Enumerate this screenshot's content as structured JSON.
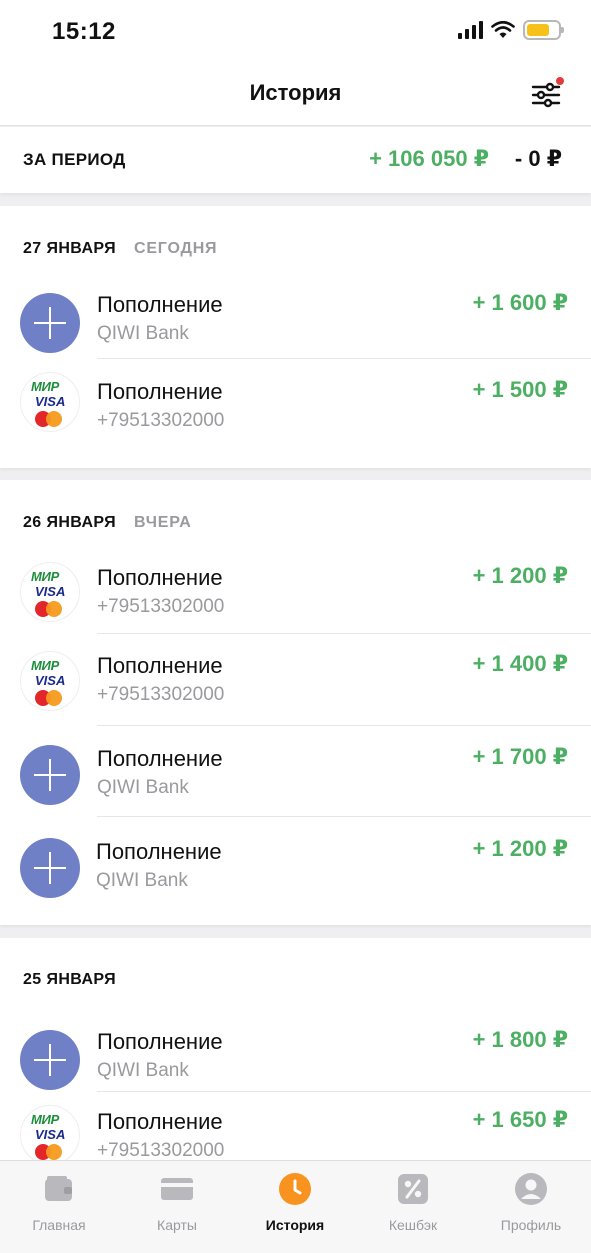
{
  "status_bar": {
    "time": "15:12"
  },
  "header": {
    "title": "История"
  },
  "period": {
    "label": "ЗА ПЕРИОД",
    "income": "+ 106 050 ₽",
    "expense": "- 0 ₽"
  },
  "sections": [
    {
      "date": "27 ЯНВАРЯ",
      "relative": "СЕГОДНЯ",
      "items": [
        {
          "title": "Пополнение",
          "subtitle": "QIWI Bank",
          "amount": "+ 1 600 ₽",
          "icon": "plus-icon"
        },
        {
          "title": "Пополнение",
          "subtitle": "+79513302000",
          "amount": "+ 1 500 ₽",
          "icon": "card-brands-icon"
        }
      ]
    },
    {
      "date": "26 ЯНВАРЯ",
      "relative": "ВЧЕРА",
      "items": [
        {
          "title": "Пополнение",
          "subtitle": "+79513302000",
          "amount": "+ 1 200 ₽",
          "icon": "card-brands-icon"
        },
        {
          "title": "Пополнение",
          "subtitle": "+79513302000",
          "amount": "+ 1 400 ₽",
          "icon": "card-brands-icon"
        },
        {
          "title": "Пополнение",
          "subtitle": "QIWI Bank",
          "amount": "+ 1 700 ₽",
          "icon": "plus-icon"
        },
        {
          "title": "Пополнение",
          "subtitle": "QIWI Bank",
          "amount": "+ 1 200 ₽",
          "icon": "plus-icon"
        }
      ]
    },
    {
      "date": "25 ЯНВАРЯ",
      "relative": "",
      "items": [
        {
          "title": "Пополнение",
          "subtitle": "QIWI Bank",
          "amount": "+ 1 800 ₽",
          "icon": "plus-icon"
        },
        {
          "title": "Пополнение",
          "subtitle": "+79513302000",
          "amount": "+ 1 650 ₽",
          "icon": "card-brands-icon"
        }
      ]
    }
  ],
  "card_brands": {
    "mir": "МИР",
    "visa": "VISA"
  },
  "tabs": [
    {
      "label": "Главная",
      "icon": "wallet-icon",
      "active": false
    },
    {
      "label": "Карты",
      "icon": "cards-icon",
      "active": false
    },
    {
      "label": "История",
      "icon": "clock-icon",
      "active": true
    },
    {
      "label": "Кешбэк",
      "icon": "percent-icon",
      "active": false
    },
    {
      "label": "Профиль",
      "icon": "profile-icon",
      "active": false
    }
  ],
  "colors": {
    "accent": "#f7931e",
    "income": "#4caf63",
    "plus_icon": "#6f80c7"
  }
}
